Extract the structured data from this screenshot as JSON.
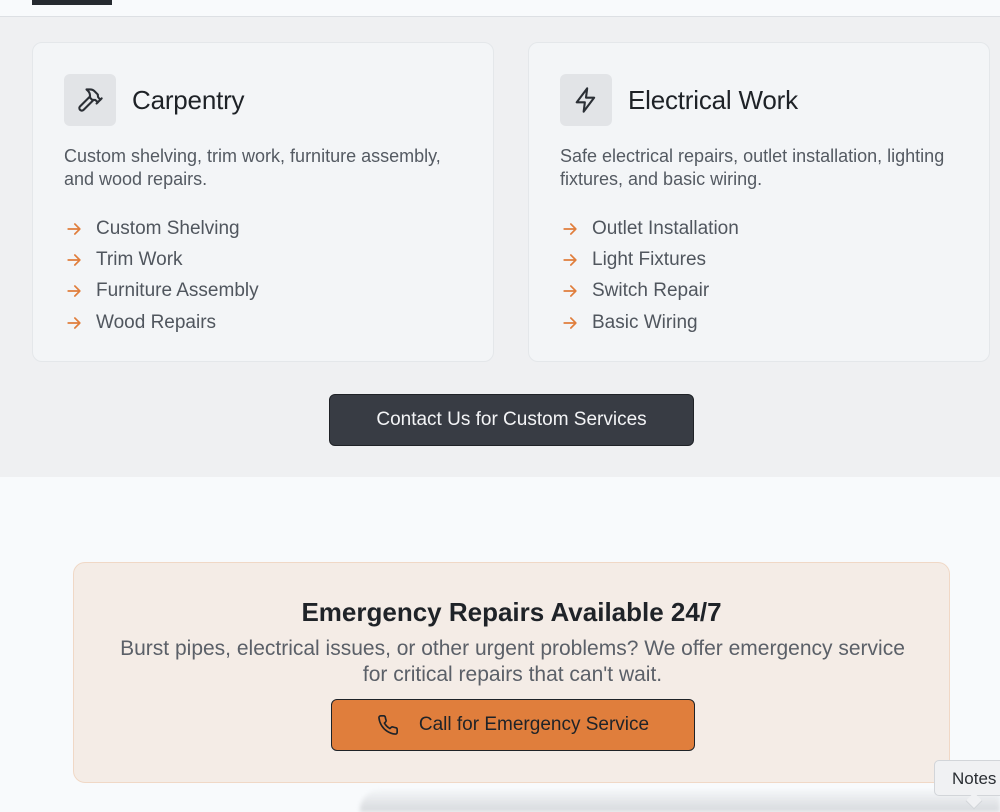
{
  "cards": [
    {
      "icon": "hammer-icon",
      "title": "Carpentry",
      "description": "Custom shelving, trim work, furniture assembly, and wood repairs.",
      "items": [
        "Custom Shelving",
        "Trim Work",
        "Furniture Assembly",
        "Wood Repairs"
      ]
    },
    {
      "icon": "lightning-bolt-icon",
      "title": "Electrical Work",
      "description": "Safe electrical repairs, outlet installation, lighting fixtures, and basic wiring.",
      "items": [
        "Outlet Installation",
        "Light Fixtures",
        "Switch Repair",
        "Basic Wiring"
      ]
    }
  ],
  "contact_button": {
    "label": "Contact Us for Custom Services"
  },
  "emergency": {
    "title": "Emergency Repairs Available 24/7",
    "description": "Burst pipes, electrical issues, or other urgent problems? We offer emergency service for critical repairs that can't wait.",
    "button_label": "Call for Emergency Service",
    "button_icon": "phone-icon"
  },
  "notes_tab": {
    "label": "Notes"
  },
  "colors": {
    "accent": "#e07e3c",
    "dark_button": "#383c44",
    "section_bg": "#eff0f2",
    "emergency_bg": "#f4ece6"
  }
}
